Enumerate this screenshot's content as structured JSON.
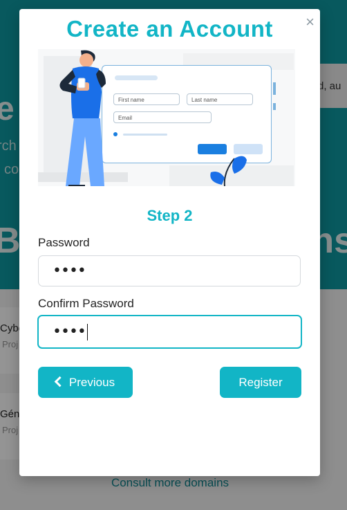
{
  "background": {
    "hero_fragment": "e",
    "hero_line1_fragment": "rch",
    "hero_line2_fragment": "co",
    "heading_left_fragment": "Br",
    "heading_right_fragment": "ns",
    "search_fragment": "d, au",
    "card1": {
      "title": "Cybe",
      "subtitle": "Proj"
    },
    "card2": {
      "title": "Géni",
      "subtitle": "Proj"
    },
    "more_link": "Consult more domains"
  },
  "modal": {
    "title": "Create an Account",
    "close_icon": "×",
    "illustration": {
      "first_name": "First name",
      "last_name": "Last name",
      "email": "Email"
    },
    "step": "Step 2",
    "password": {
      "label": "Password",
      "value": "••••"
    },
    "confirm_password": {
      "label": "Confirm Password",
      "value": "••••"
    },
    "buttons": {
      "previous": "Previous",
      "register": "Register"
    }
  },
  "colors": {
    "accent": "#12b5c6",
    "backdrop": "#0f9aa3"
  }
}
